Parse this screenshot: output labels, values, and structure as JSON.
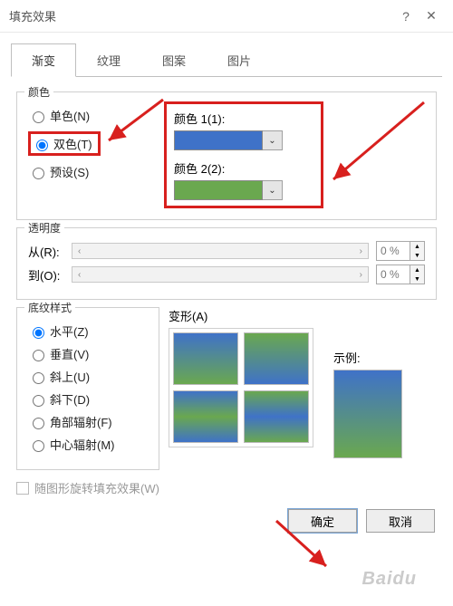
{
  "window": {
    "title": "填充效果"
  },
  "tabs": {
    "gradient": "渐变",
    "texture": "纹理",
    "pattern": "图案",
    "picture": "图片",
    "active": "gradient"
  },
  "colors_group": {
    "legend": "颜色",
    "one": "单色(N)",
    "two": "双色(T)",
    "preset": "预设(S)",
    "selected": "two",
    "color1_label": "颜色 1(1):",
    "color2_label": "颜色 2(2):",
    "color1": "#3f72c8",
    "color2": "#6aa84f"
  },
  "transparency": {
    "legend": "透明度",
    "from_label": "从(R):",
    "to_label": "到(O):",
    "from_value": "0 %",
    "to_value": "0 %"
  },
  "shading": {
    "legend": "底纹样式",
    "horizontal": "水平(Z)",
    "vertical": "垂直(V)",
    "diag_up": "斜上(U)",
    "diag_down": "斜下(D)",
    "corner": "角部辐射(F)",
    "center": "中心辐射(M)",
    "selected": "horizontal"
  },
  "variants": {
    "label": "变形(A)"
  },
  "sample": {
    "label": "示例:"
  },
  "rotate": {
    "label": "随图形旋转填充效果(W)"
  },
  "buttons": {
    "ok": "确定",
    "cancel": "取消"
  },
  "watermark": "Baidu"
}
